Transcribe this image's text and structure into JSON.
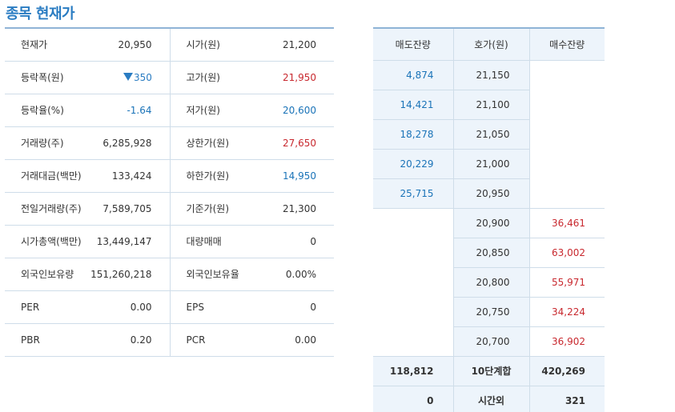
{
  "title": "종목 현재가",
  "colors": {
    "up": "#c8282e",
    "down": "#1a73b8",
    "title": "#2a7cc2",
    "header_bg": "#edf4fb"
  },
  "summary": [
    {
      "l1": "현재가",
      "v1": "20,950",
      "l2": "시가(원)",
      "v2": "21,200"
    },
    {
      "l1": "등락폭(원)",
      "v1": "350",
      "l2": "고가(원)",
      "v2": "21,950"
    },
    {
      "l1": "등락율(%)",
      "v1": "-1.64",
      "l2": "저가(원)",
      "v2": "20,600"
    },
    {
      "l1": "거래량(주)",
      "v1": "6,285,928",
      "l2": "상한가(원)",
      "v2": "27,650"
    },
    {
      "l1": "거래대금(백만)",
      "v1": "133,424",
      "l2": "하한가(원)",
      "v2": "14,950"
    },
    {
      "l1": "전일거래량(주)",
      "v1": "7,589,705",
      "l2": "기준가(원)",
      "v2": "21,300"
    },
    {
      "l1": "시가총액(백만)",
      "v1": "13,449,147",
      "l2": "대량매매",
      "v2": "0"
    },
    {
      "l1": "외국인보유량",
      "v1": "151,260,218",
      "l2": "외국인보유율",
      "v2": "0.00%"
    },
    {
      "l1": "PER",
      "v1": "0.00",
      "l2": "EPS",
      "v2": "0"
    },
    {
      "l1": "PBR",
      "v1": "0.20",
      "l2": "PCR",
      "v2": "0.00"
    }
  ],
  "orderbook": {
    "headers": [
      "매도잔량",
      "호가(원)",
      "매수잔량"
    ],
    "asks": [
      {
        "qty": "4,874",
        "price": "21,150"
      },
      {
        "qty": "14,421",
        "price": "21,100"
      },
      {
        "qty": "18,278",
        "price": "21,050"
      },
      {
        "qty": "20,229",
        "price": "21,000"
      },
      {
        "qty": "25,715",
        "price": "20,950"
      }
    ],
    "bids": [
      {
        "price": "20,900",
        "qty": "36,461"
      },
      {
        "price": "20,850",
        "qty": "63,002"
      },
      {
        "price": "20,800",
        "qty": "55,971"
      },
      {
        "price": "20,750",
        "qty": "34,224"
      },
      {
        "price": "20,700",
        "qty": "36,902"
      }
    ],
    "total": {
      "ask": "118,812",
      "label": "10단계합",
      "bid": "420,269"
    },
    "after_hours": {
      "ask": "0",
      "label": "시간외",
      "bid": "321"
    }
  }
}
